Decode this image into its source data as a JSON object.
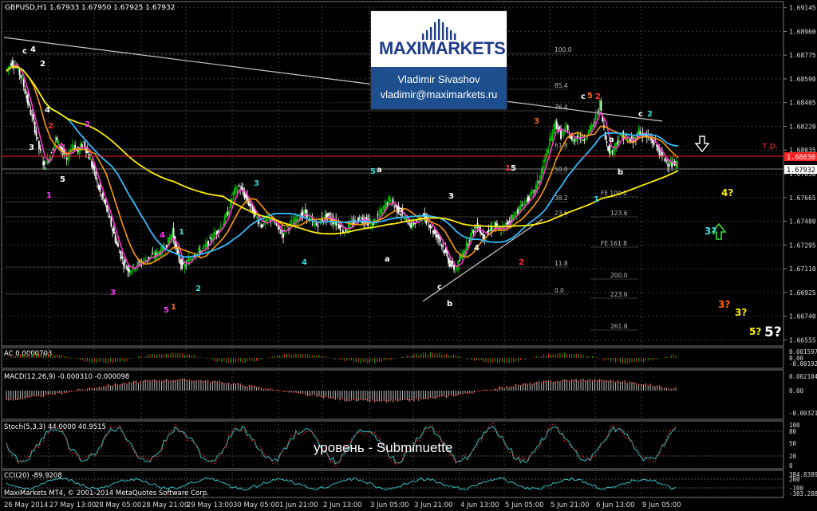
{
  "window": {
    "symbol_line": "GBPUSD,H1  1.67933 1.67950 1.67925 1.67932",
    "footer": "MaxiMarkets MT4, © 2001-2014 MetaQuotes Software Corp."
  },
  "brand": {
    "word_left": "MAXI",
    "word_right": "MARKETS",
    "author": "Vladimir Sivashov",
    "email": "vladimir@maximarkets.ru"
  },
  "annotation_subtitle": "уровень - Subminuette",
  "colors": {
    "background": "#000000",
    "grid": "#3a3a3a",
    "bull_candle": "#00c000",
    "bear_candle": "#ffffff",
    "ma_fast": "#ff33cc",
    "ma_mid": "#ff9900",
    "ma_blue": "#33bbff",
    "ma_slow": "#ffee00",
    "tp_line": "#ff2020",
    "price_label_bg": "#ff2020"
  },
  "chart_data": [
    {
      "type": "line",
      "panel": "main",
      "symbol": "GBPUSD",
      "timeframe": "H1",
      "y_ticks": [
        "1.69145",
        "1.68960",
        "1.68775",
        "1.68590",
        "1.68405",
        "1.68220",
        "1.68035",
        "1.67850",
        "1.67665",
        "1.67480",
        "1.67295",
        "1.67110",
        "1.66925",
        "1.66740",
        "1.66555"
      ],
      "ylim": [
        1.6652,
        1.6918
      ],
      "x_tick_labels": [
        "26 May 2014",
        "27 May 13:00",
        "28 May 05:00",
        "28 May 21:00",
        "29 May 13:00",
        "30 May 05:00",
        "1 Jun 21:00",
        "2 Jun 13:00",
        "3 Jun 05:00",
        "3 Jun 21:00",
        "4 Jun 13:00",
        "5 Jun 05:00",
        "5 Jun 21:00",
        "6 Jun 13:00",
        "9 Jun 05:00"
      ],
      "current_price": "1.67932",
      "tp_price": "1.68030",
      "tp_label": "т.р.",
      "fib_labels": [
        "100.0",
        "85.4",
        "76.4",
        "61.8",
        "50.0",
        "38.2",
        "23.6",
        "11.8",
        "0.0",
        "FE 100.0",
        "123.6",
        "FE 161.8",
        "200.0",
        "223.6",
        "261.8"
      ],
      "close_series": [
        1.6865,
        1.6872,
        1.6868,
        1.6858,
        1.684,
        1.6825,
        1.6805,
        1.679,
        1.68,
        1.6812,
        1.6805,
        1.6795,
        1.6808,
        1.6802,
        1.681,
        1.6798,
        1.6785,
        1.677,
        1.676,
        1.6745,
        1.673,
        1.6718,
        1.671,
        1.6712,
        1.6715,
        1.6718,
        1.672,
        1.6722,
        1.6725,
        1.673,
        1.674,
        1.672,
        1.6712,
        1.6718,
        1.6722,
        1.6725,
        1.6728,
        1.6735,
        1.674,
        1.6745,
        1.6755,
        1.677,
        1.6775,
        1.6768,
        1.676,
        1.6752,
        1.6745,
        1.6748,
        1.675,
        1.6742,
        1.6738,
        1.6745,
        1.6748,
        1.6752,
        1.6755,
        1.6748,
        1.6745,
        1.675,
        1.6752,
        1.6748,
        1.6745,
        1.674,
        1.6745,
        1.6748,
        1.675,
        1.6748,
        1.6745,
        1.6752,
        1.6758,
        1.6765,
        1.676,
        1.6755,
        1.675,
        1.6745,
        1.6748,
        1.6752,
        1.6748,
        1.674,
        1.6735,
        1.6725,
        1.6715,
        1.671,
        1.672,
        1.673,
        1.674,
        1.6745,
        1.6735,
        1.674,
        1.6745,
        1.674,
        1.6745,
        1.675,
        1.6755,
        1.676,
        1.6765,
        1.677,
        1.678,
        1.6795,
        1.681,
        1.6825,
        1.6815,
        1.682,
        1.681,
        1.6815,
        1.6812,
        1.6818,
        1.6825,
        1.684,
        1.6812,
        1.68,
        1.681,
        1.6815,
        1.6812,
        1.681,
        1.6818,
        1.6815,
        1.6812,
        1.6808,
        1.68,
        1.6795,
        1.6792,
        1.6793
      ]
    },
    {
      "type": "bar",
      "panel": "AC",
      "title": "AC 0.0000703",
      "y_ticks": [
        "0.001597",
        "0.00",
        "-0.001923"
      ]
    },
    {
      "type": "bar",
      "panel": "MACD",
      "title": "MACD(12,26,9) -0.000310 -0.000098",
      "y_ticks": [
        "0.002104",
        "0.00",
        "-0.003217"
      ]
    },
    {
      "type": "line",
      "panel": "Stoch",
      "title": "Stoch(5,3,3) 44.0000 40.9515",
      "y_ticks": [
        "100",
        "80",
        "50",
        "20",
        "0"
      ]
    },
    {
      "type": "line",
      "panel": "CCI",
      "title": "CCI(20) -89.9208",
      "y_ticks": [
        "384.8389",
        "200",
        "-100",
        "-383.2889"
      ]
    }
  ],
  "wave_labels": [
    {
      "t": "c",
      "c": "#ffffff"
    },
    {
      "t": "4",
      "c": "#ffffff"
    },
    {
      "t": "2",
      "c": "#ffffff"
    },
    {
      "t": "4",
      "c": "#ffffff"
    },
    {
      "t": "2",
      "c": "#ff3030"
    },
    {
      "t": "3",
      "c": "#ffffff"
    },
    {
      "t": "5",
      "c": "#ffffff"
    },
    {
      "t": "1",
      "c": "#ff33ff"
    },
    {
      "t": "2",
      "c": "#ff33ff"
    },
    {
      "t": "3",
      "c": "#ff33ff"
    },
    {
      "t": "4",
      "c": "#ff33ff"
    },
    {
      "t": "5",
      "c": "#ff33ff"
    },
    {
      "t": "1",
      "c": "#ff6600"
    },
    {
      "t": "1",
      "c": "#33dddd"
    },
    {
      "t": "2",
      "c": "#33dddd"
    },
    {
      "t": "3",
      "c": "#33dddd"
    },
    {
      "t": "4",
      "c": "#33dddd"
    },
    {
      "t": "5",
      "c": "#33dddd"
    },
    {
      "t": "a",
      "c": "#ffffff"
    },
    {
      "t": "b",
      "c": "#ffffff"
    },
    {
      "t": "a",
      "c": "#ffffff"
    },
    {
      "t": "3",
      "c": "#ffffff"
    },
    {
      "t": "c",
      "c": "#ffffff"
    },
    {
      "t": "b",
      "c": "#ffffff"
    },
    {
      "t": "2",
      "c": "#ffffff"
    },
    {
      "t": "4",
      "c": "#ffffff"
    },
    {
      "t": "1",
      "c": "#ff3030"
    },
    {
      "t": "5",
      "c": "#ffffff"
    },
    {
      "t": "2",
      "c": "#ff3030"
    },
    {
      "t": "3",
      "c": "#ff6600"
    },
    {
      "t": "c",
      "c": "#ffffff"
    },
    {
      "t": "5",
      "c": "#ff6600"
    },
    {
      "t": "2",
      "c": "#ff3030"
    },
    {
      "t": "a",
      "c": "#ffffff"
    },
    {
      "t": "b",
      "c": "#ffffff"
    },
    {
      "t": "c",
      "c": "#ffffff"
    },
    {
      "t": "2",
      "c": "#33dddd"
    },
    {
      "t": "1",
      "c": "#33dddd"
    },
    {
      "t": "4?",
      "c": "#ffee00"
    },
    {
      "t": "3?",
      "c": "#33dddd"
    },
    {
      "t": "3?",
      "c": "#ff6600"
    },
    {
      "t": "3?",
      "c": "#ffee00"
    },
    {
      "t": "5?",
      "c": "#ffee00"
    },
    {
      "t": "5?",
      "c": "#ffffff"
    }
  ]
}
